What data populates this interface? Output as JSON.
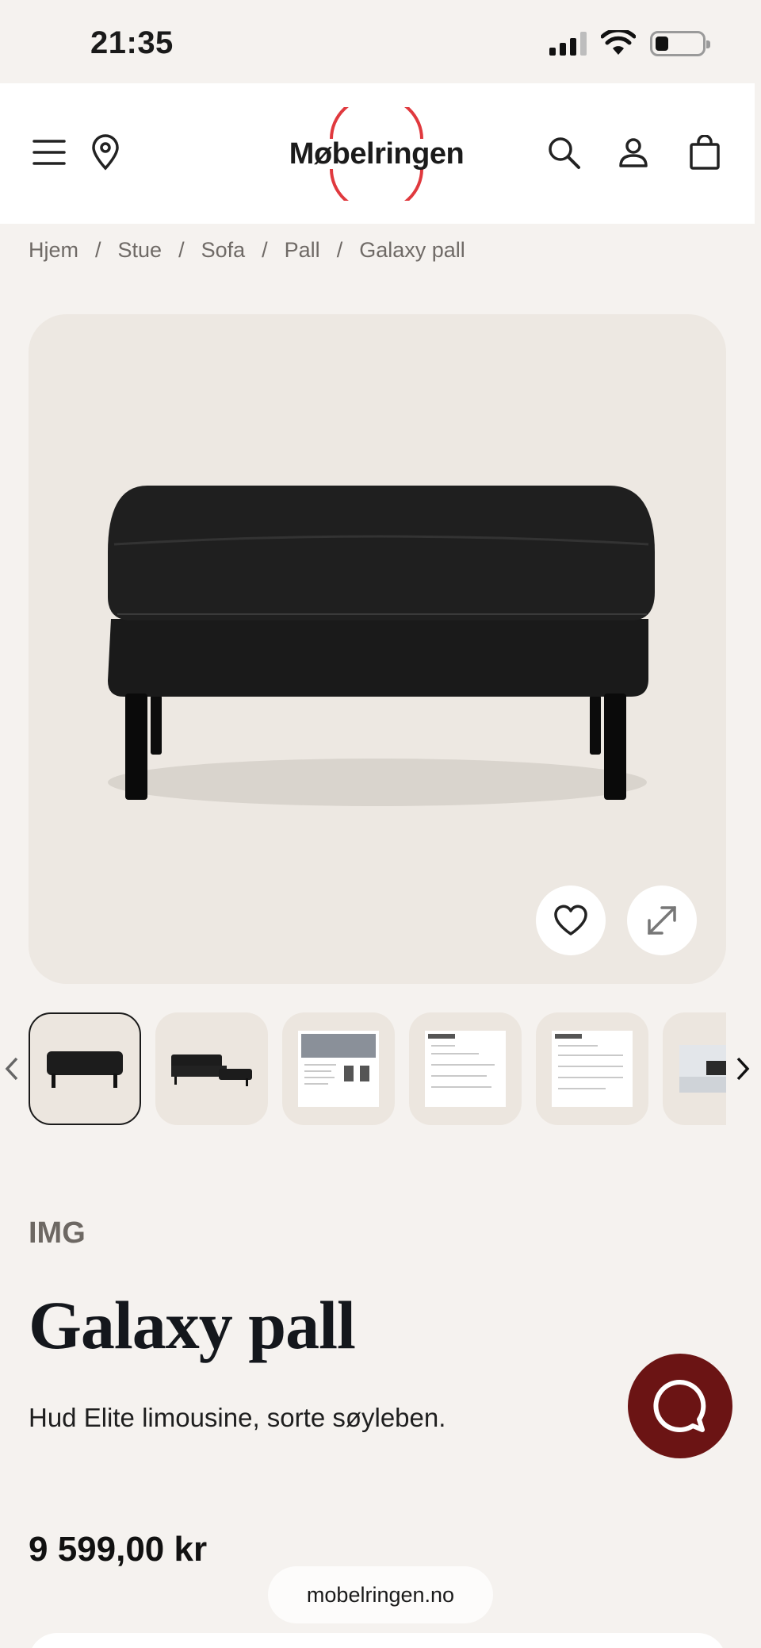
{
  "status_bar": {
    "time": "21:35"
  },
  "header": {
    "menu_icon": "menu-icon",
    "location_icon": "map-pin-icon",
    "logo_text": "Møbelringen",
    "search_icon": "search-icon",
    "account_icon": "user-icon",
    "cart_icon": "shopping-bag-icon"
  },
  "breadcrumb": [
    "Hjem",
    "Stue",
    "Sofa",
    "Pall",
    "Galaxy pall"
  ],
  "gallery": {
    "favorite_icon": "heart-icon",
    "expand_icon": "expand-icon",
    "thumbnail_count_visible": 6
  },
  "product": {
    "brand": "IMG",
    "title": "Galaxy pall",
    "description": "Hud Elite limousine, sorte søyleben.",
    "price": "9 599,00 kr"
  },
  "browser": {
    "url": "mobelringen.no"
  },
  "colors": {
    "background": "#f5f2ef",
    "logo_ring": "#e0393e",
    "chat_button": "#6b1414"
  }
}
